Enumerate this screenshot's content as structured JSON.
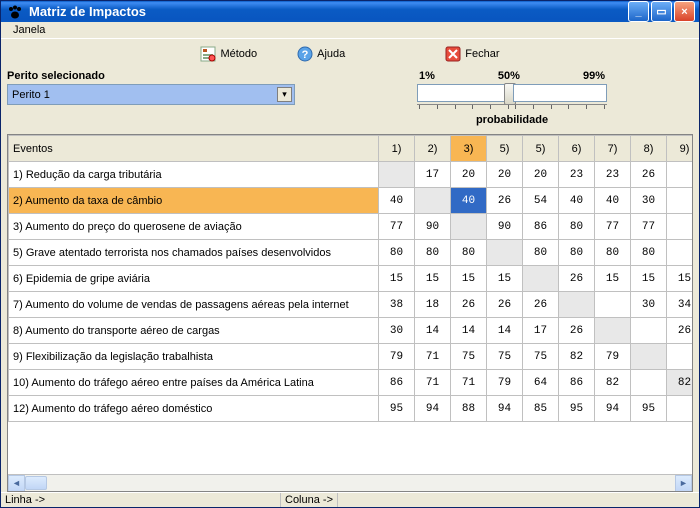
{
  "window": {
    "title": "Matriz de Impactos"
  },
  "menu": {
    "janela": "Janela"
  },
  "toolbar": {
    "metodo": "Método",
    "ajuda": "Ajuda",
    "fechar": "Fechar"
  },
  "expert": {
    "label": "Perito selecionado",
    "value": "Perito 1"
  },
  "slider": {
    "min": "1%",
    "mid": "50%",
    "max": "99%",
    "caption": "probabilidade"
  },
  "table": {
    "events_header": "Eventos",
    "cols": [
      "1)",
      "2)",
      "3)",
      "5)",
      "5)",
      "6)",
      "7)",
      "8)",
      "9)"
    ],
    "selected_col_index": 2,
    "selected_row_index": 1,
    "edit_value": "40",
    "rows": [
      {
        "label": "1) Redução da carga tributária",
        "cells": [
          "",
          "17",
          "20",
          "20",
          "20",
          "23",
          "23",
          "26",
          ""
        ],
        "diag": 0
      },
      {
        "label": "2) Aumento da taxa de câmbio",
        "cells": [
          "40",
          "",
          "40",
          "26",
          "54",
          "40",
          "40",
          "30",
          ""
        ],
        "diag": 1
      },
      {
        "label": "3) Aumento do preço do querosene de aviação",
        "cells": [
          "77",
          "90",
          "",
          "90",
          "86",
          "80",
          "77",
          "77",
          ""
        ],
        "diag": 2
      },
      {
        "label": "5) Grave atentado terrorista nos chamados países desenvolvidos",
        "cells": [
          "80",
          "80",
          "80",
          "",
          "80",
          "80",
          "80",
          "80",
          ""
        ],
        "diag": 3
      },
      {
        "label": "6) Epidemia de gripe aviária",
        "cells": [
          "15",
          "15",
          "15",
          "15",
          "",
          "26",
          "15",
          "15",
          "15"
        ],
        "diag": 4
      },
      {
        "label": "7) Aumento do volume de vendas de passagens aéreas pela internet",
        "cells": [
          "38",
          "18",
          "26",
          "26",
          "26",
          "",
          "",
          "30",
          "34"
        ],
        "diag": 5
      },
      {
        "label": "8) Aumento do transporte aéreo de cargas",
        "cells": [
          "30",
          "14",
          "14",
          "14",
          "17",
          "26",
          "",
          "",
          "26"
        ],
        "diag": 6
      },
      {
        "label": "9) Flexibilização da legislação trabalhista",
        "cells": [
          "79",
          "71",
          "75",
          "75",
          "75",
          "82",
          "79",
          "",
          ""
        ],
        "diag": 7
      },
      {
        "label": "10) Aumento do tráfego aéreo entre países da América Latina",
        "cells": [
          "86",
          "71",
          "71",
          "79",
          "64",
          "86",
          "82",
          "",
          "82"
        ],
        "diag": 8
      },
      {
        "label": "12) Aumento do tráfego aéreo doméstico",
        "cells": [
          "95",
          "94",
          "88",
          "94",
          "85",
          "95",
          "94",
          "95",
          ""
        ],
        "diag": -1
      }
    ]
  },
  "status": {
    "linha": "Linha ->",
    "coluna": "Coluna ->"
  }
}
